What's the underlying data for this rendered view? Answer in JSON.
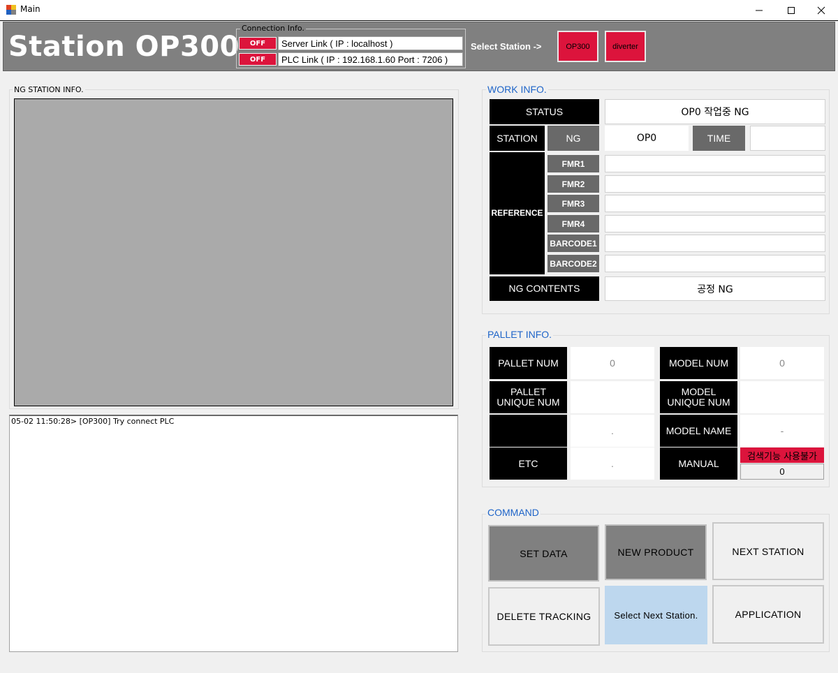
{
  "window": {
    "title": "Main",
    "controls": {
      "minimize": "—",
      "maximize": "☐",
      "close": "✕"
    }
  },
  "header": {
    "station_title": "Station OP300",
    "connection_legend": "Connection Info.",
    "server_status": "OFF",
    "server_link": "Server Link ( IP : localhost )",
    "plc_status": "OFF",
    "plc_link": "PLC Link ( IP : 192.168.1.60 Port : 7206 )",
    "select_station_label": "Select Station ->",
    "stations": [
      "OP300",
      "diverter"
    ],
    "status_color": "#dc143c"
  },
  "ng_station": {
    "title": "NG STATION INFO.",
    "log_lines": [
      "05-02 11:50:28> [OP300] Try connect PLC"
    ]
  },
  "work_info": {
    "title": "WORK INFO.",
    "status_label": "STATUS",
    "status_value": "OP0  작업중 NG",
    "station_label": "STATION",
    "ng_label": "NG",
    "station_value": "OP0",
    "time_label": "TIME",
    "time_value": "",
    "reference_label": "REFERENCE",
    "references": [
      {
        "label": "FMR1",
        "value": ""
      },
      {
        "label": "FMR2",
        "value": ""
      },
      {
        "label": "FMR3",
        "value": ""
      },
      {
        "label": "FMR4",
        "value": ""
      },
      {
        "label": "BARCODE1",
        "value": ""
      },
      {
        "label": "BARCODE2",
        "value": ""
      }
    ],
    "ng_contents_label": "NG CONTENTS",
    "ng_contents_value": "공정 NG"
  },
  "pallet_info": {
    "title": "PALLET INFO.",
    "pallet_num_label": "PALLET NUM",
    "pallet_num_value": "0",
    "pallet_unique_label": "PALLET\nUNIQUE NUM",
    "pallet_unique_value": "",
    "blank_label": "",
    "blank_value": ".",
    "etc_label": "ETC",
    "etc_value": ".",
    "model_num_label": "MODEL NUM",
    "model_num_value": "0",
    "model_unique_label": "MODEL\nUNIQUE NUM",
    "model_unique_value": "",
    "model_name_label": "MODEL NAME",
    "model_name_value": "-",
    "manual_label": "MANUAL",
    "manual_warning": "검색기능 사용불가",
    "manual_value": "0"
  },
  "command": {
    "title": "COMMAND",
    "set_data": "SET DATA",
    "new_product": "NEW PRODUCT",
    "next_station": "NEXT STATION",
    "delete_tracking": "DELETE TRACKING",
    "select_next_station": "Select Next Station.",
    "application": "APPLICATION"
  }
}
